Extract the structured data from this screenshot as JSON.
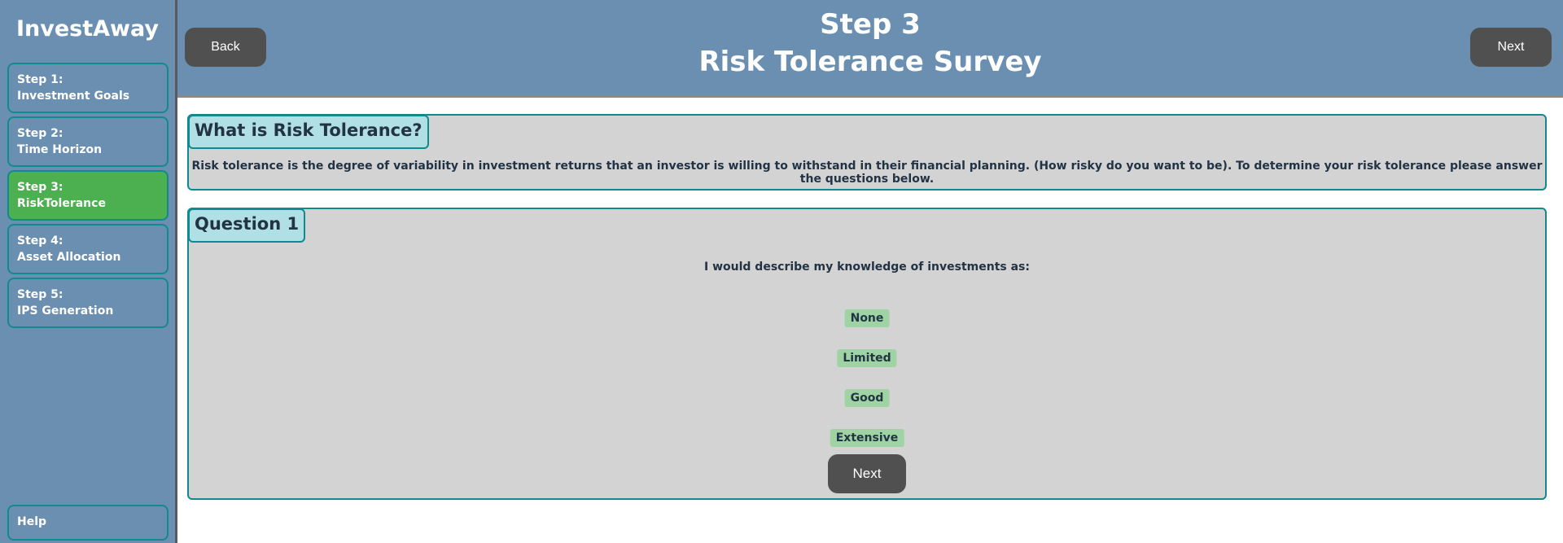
{
  "app": {
    "name": "InvestAway"
  },
  "sidebar": {
    "steps": [
      {
        "number": "Step 1:",
        "label": "Investment Goals",
        "active": false
      },
      {
        "number": "Step 2:",
        "label": "Time Horizon",
        "active": false
      },
      {
        "number": "Step 3:",
        "label": "RiskTolerance",
        "active": true
      },
      {
        "number": "Step 4:",
        "label": "Asset Allocation",
        "active": false
      },
      {
        "number": "Step 5:",
        "label": "IPS Generation",
        "active": false
      }
    ],
    "help_label": "Help"
  },
  "header": {
    "step": "Step 3",
    "title": "Risk Tolerance Survey",
    "back_label": "Back",
    "next_label": "Next"
  },
  "info": {
    "heading": "What is Risk Tolerance?",
    "text": "Risk tolerance is the degree of variability in investment returns that an investor is willing to withstand in their financial planning. (How risky do you want to be). To determine your risk tolerance please answer the questions below."
  },
  "question": {
    "heading": "Question 1",
    "prompt": "I would describe my knowledge of investments as:",
    "options": [
      "None",
      "Limited",
      "Good",
      "Extensive"
    ],
    "next_label": "Next"
  },
  "colors": {
    "sidebar_bg": "#6b8fb1",
    "accent_border": "#0f8b8d",
    "active_step": "#4caf50",
    "option_bg": "#9fd3a4",
    "button_bg": "#505050",
    "panel_bg": "#d3d3d3"
  }
}
